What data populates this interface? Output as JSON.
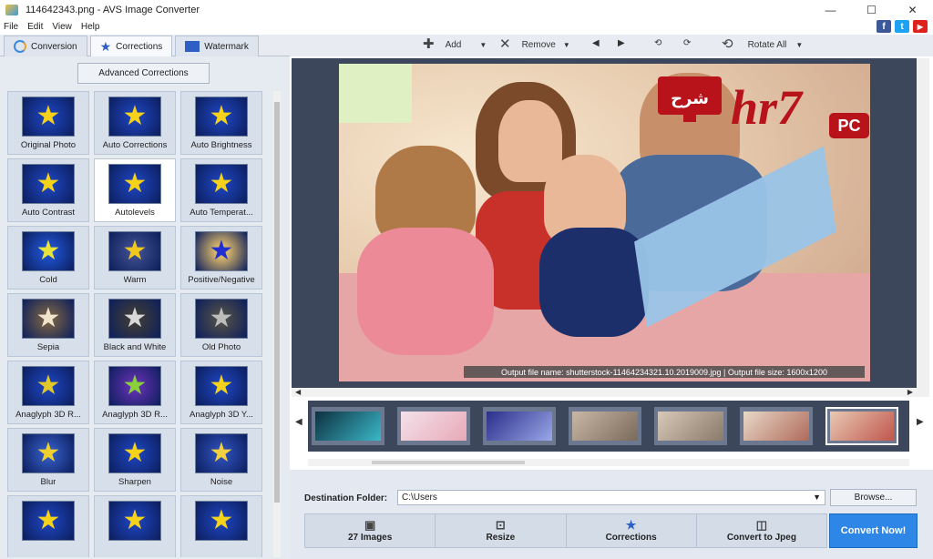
{
  "window": {
    "title": "114642343.png - AVS Image Converter",
    "controls": [
      "—",
      "☐",
      "✕"
    ]
  },
  "menu": [
    "File",
    "Edit",
    "View",
    "Help"
  ],
  "social": [
    "f",
    "t",
    "▶"
  ],
  "tabs": [
    {
      "label": "Conversion",
      "icon": "conversion-icon"
    },
    {
      "label": "Corrections",
      "icon": "star-icon"
    },
    {
      "label": "Watermark",
      "icon": "watermark-icon"
    }
  ],
  "toolbar": {
    "add": "Add",
    "remove": "Remove",
    "rotate_all": "Rotate All"
  },
  "left": {
    "advanced_button": "Advanced Corrections",
    "tiles": [
      {
        "label": "Original Photo",
        "bg": "#1b3fb0",
        "star": "#f7d21a"
      },
      {
        "label": "Auto Corrections",
        "bg": "#1b3fb0",
        "star": "#f7d21a"
      },
      {
        "label": "Auto Brightness",
        "bg": "#1b3fb0",
        "star": "#f7d21a"
      },
      {
        "label": "Auto Contrast",
        "bg": "#1b3fb0",
        "star": "#f7d21a"
      },
      {
        "label": "Autolevels",
        "bg": "#1b3fb0",
        "star": "#f7d21a",
        "selected": true
      },
      {
        "label": "Auto Temperat...",
        "bg": "#1b3fb0",
        "star": "#f7d21a"
      },
      {
        "label": "Cold",
        "bg": "#1d4fc8",
        "star": "#e8e43a"
      },
      {
        "label": "Warm",
        "bg": "#3a4a8a",
        "star": "#f2c81c"
      },
      {
        "label": "Positive/Negative",
        "bg": "#d9b76a",
        "star": "#1f2fd0"
      },
      {
        "label": "Sepia",
        "bg": "#6b5a48",
        "star": "#f0e4cc"
      },
      {
        "label": "Black and White",
        "bg": "#3a3a3a",
        "star": "#d8d8d8"
      },
      {
        "label": "Old Photo",
        "bg": "#4a4a4a",
        "star": "#bdbdbd"
      },
      {
        "label": "Anaglyph 3D R...",
        "bg": "#1b3fb0",
        "star": "#e0c82a"
      },
      {
        "label": "Anaglyph 3D R...",
        "bg": "#5a2fa8",
        "star": "#8ad03a"
      },
      {
        "label": "Anaglyph 3D Y...",
        "bg": "#1b3fb0",
        "star": "#f7d21a"
      },
      {
        "label": "Blur",
        "bg": "#2f55b8",
        "star": "#f0d030"
      },
      {
        "label": "Sharpen",
        "bg": "#1b3fb0",
        "star": "#f7d21a"
      },
      {
        "label": "Noise",
        "bg": "#2a4ab0",
        "star": "#f0d040"
      },
      {
        "label": "",
        "bg": "#1b3fb0",
        "star": "#f7d21a"
      },
      {
        "label": "",
        "bg": "#1b3fb0",
        "star": "#f7d21a"
      },
      {
        "label": "",
        "bg": "#1b3fb0",
        "star": "#f7d21a"
      }
    ]
  },
  "preview": {
    "caption": "Output file name: shutterstock-11464234321.10.2019009.jpg | Output file size: 1600x1200",
    "logo_text": "hr7",
    "logo_badge": "PC",
    "logo_arabic": "شرح"
  },
  "filmstrip": [
    {
      "c1": "#0e3040",
      "c2": "#3ab8c8"
    },
    {
      "c1": "#f3e1ea",
      "c2": "#e8a9b8"
    },
    {
      "c1": "#2a2e8a",
      "c2": "#9aa8e8"
    },
    {
      "c1": "#c9b8a6",
      "c2": "#7a6a5a"
    },
    {
      "c1": "#d8c8b8",
      "c2": "#8a7a6a"
    },
    {
      "c1": "#e8d8c8",
      "c2": "#b06a5a"
    },
    {
      "c1": "#e9c9b4",
      "c2": "#c0564c",
      "selected": true
    }
  ],
  "bottom": {
    "dest_label": "Destination Folder:",
    "dest_value": "C:\\Users",
    "browse": "Browse...",
    "steps": [
      {
        "label": "27 Images",
        "icon": "image-icon"
      },
      {
        "label": "Resize",
        "icon": "resize-icon"
      },
      {
        "label": "Corrections",
        "icon": "star-icon"
      },
      {
        "label": "Convert to Jpeg",
        "icon": "convert-icon"
      }
    ],
    "convert": "Convert Now!"
  },
  "colors": {
    "accent": "#2e86e6",
    "panel": "#e6ebf2",
    "preview_bg": "#3d475c",
    "logo_red": "#b8131a"
  }
}
